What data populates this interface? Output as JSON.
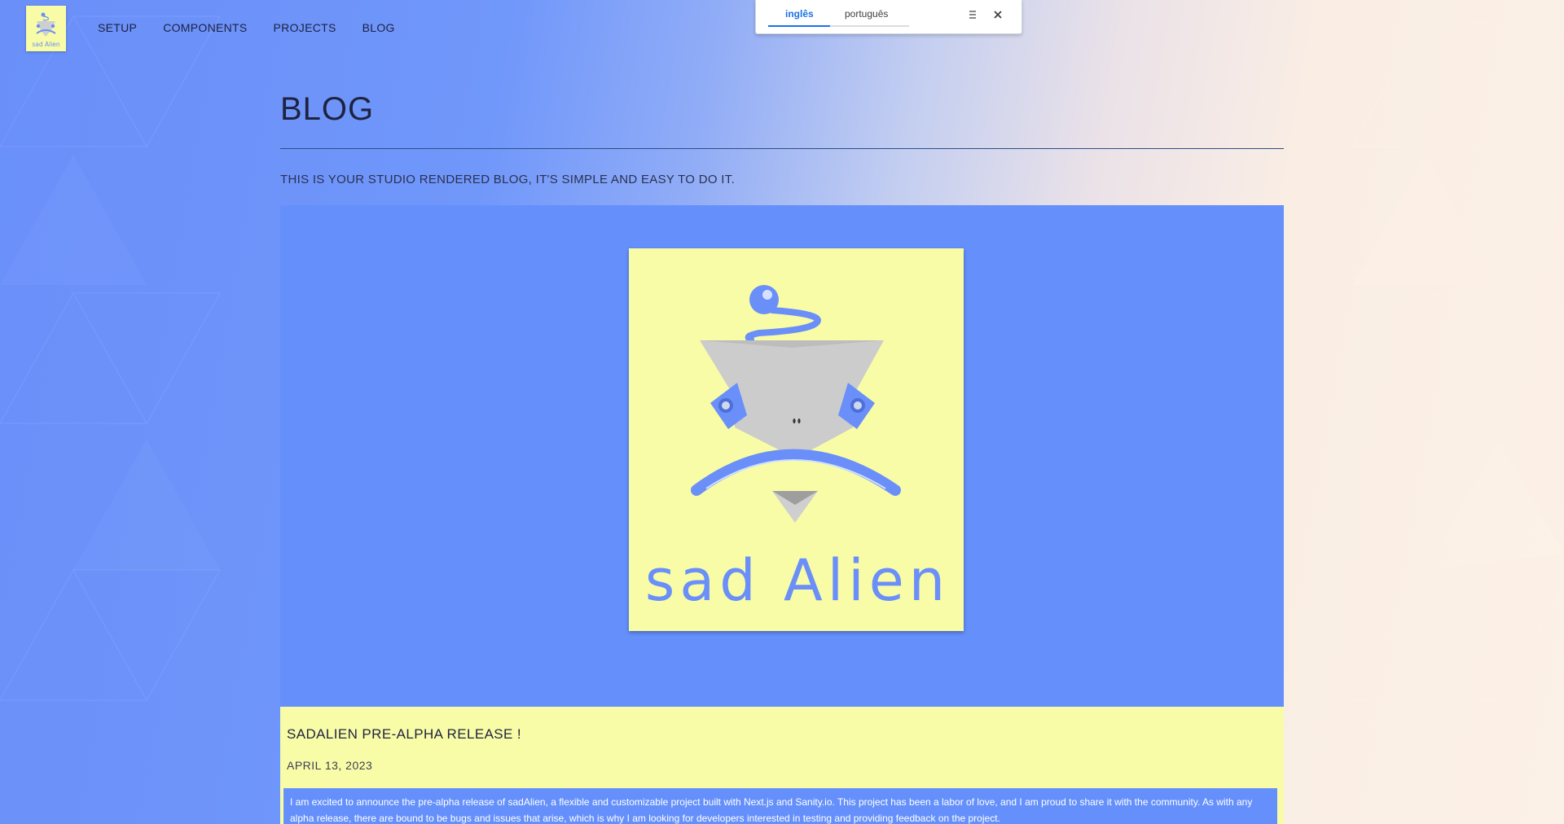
{
  "header": {
    "logo_text": "sad Alien",
    "nav": [
      "SETUP",
      "COMPONENTS",
      "PROJECTS",
      "BLOG"
    ]
  },
  "translate_bar": {
    "tabs": [
      "inglês",
      "português"
    ],
    "active_tab": "inglês",
    "menu_icon": "menu-icon",
    "close_icon": "close-icon"
  },
  "main": {
    "title": "BLOG",
    "subtitle": "THIS IS YOUR STUDIO RENDERED BLOG, IT'S SIMPLE AND EASY TO DO IT.",
    "post": {
      "image_text": "sad Alien",
      "title": "SADALIEN PRE-ALPHA RELEASE !",
      "date": "APRIL 13, 2023",
      "excerpt": "I am excited to announce the pre-alpha release of sadAlien, a flexible and customizable project built with Next.js and Sanity.io. This project has been a labor of love, and I am proud to share it with the community. As with any alpha release, there are bound to be bugs and issues that arise, which is why I am looking for developers interested in testing and providing feedback on the project."
    }
  },
  "colors": {
    "accent_blue": "#6590fc",
    "card_yellow": "#f9fca6",
    "text_dark": "#1e2340"
  }
}
